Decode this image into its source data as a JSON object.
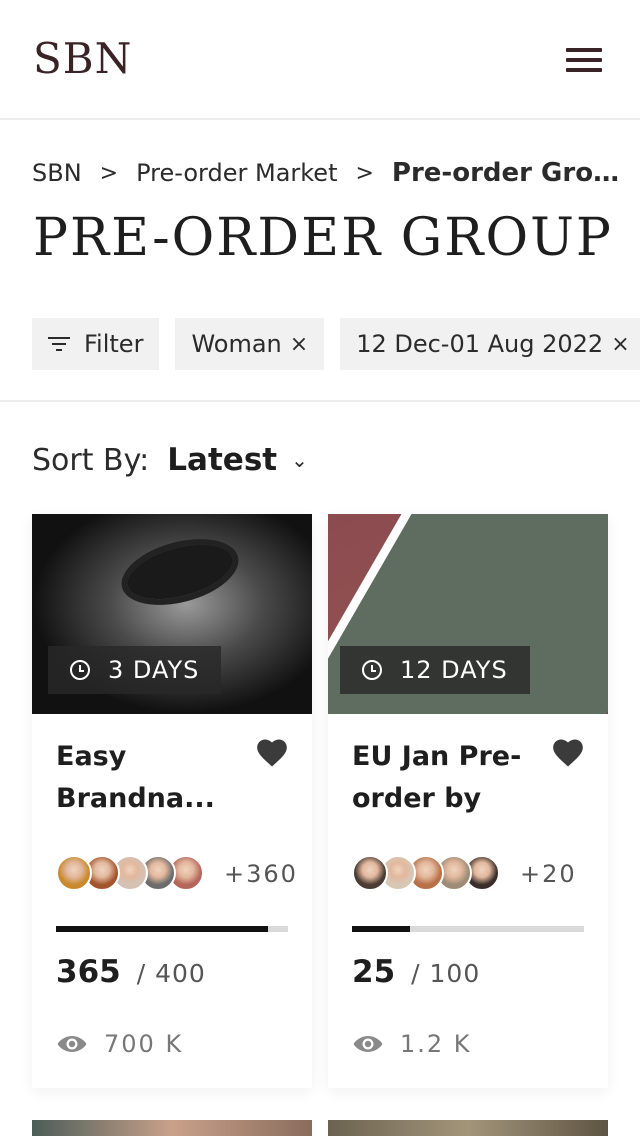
{
  "header": {
    "logo": "SBN",
    "menu_icon": "hamburger-menu-icon"
  },
  "breadcrumb": {
    "items": [
      "SBN",
      "Pre-order Market"
    ],
    "current": "Pre-order Gro..."
  },
  "page": {
    "title": "PRE-ORDER GROUP"
  },
  "filters": {
    "filter_label": "Filter",
    "chips": [
      "Woman",
      "12 Dec-01 Aug 2022"
    ],
    "remove_symbol": "×"
  },
  "sort": {
    "label": "Sort By:",
    "value": "Latest"
  },
  "cards": [
    {
      "days": "3 DAYS",
      "title": "Easy Brandna...",
      "avatar_colors": [
        "#c9892e",
        "#a2552c",
        "#d4c2b5",
        "#6c6c6c",
        "#b5665a"
      ],
      "extra": "+360",
      "current": "365",
      "total": "/ 400",
      "progress": 0.9125,
      "views": "700 K"
    },
    {
      "days": "12 DAYS",
      "title": "EU Jan Pre-order by K...",
      "avatar_colors": [
        "#4a3b33",
        "#d8c7b5",
        "#b87046",
        "#9e8b76",
        "#3a2e2a"
      ],
      "extra": "+20",
      "current": "25",
      "total": "/ 100",
      "progress": 0.25,
      "views": "1.2 K"
    }
  ],
  "colors": {
    "accent": "#3a2326",
    "chip_bg": "#f1f1f1",
    "progress_fill": "#111111",
    "progress_track": "#d9d9d9"
  }
}
